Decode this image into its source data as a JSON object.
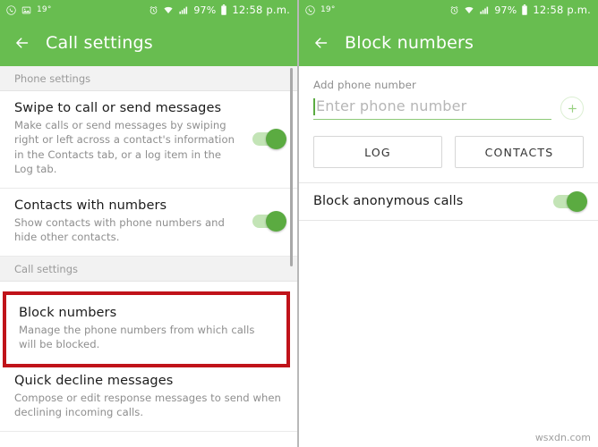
{
  "accent_green": "#68bd50",
  "highlight_red": "#c0131a",
  "toggle_on_color": "#5bab41",
  "left": {
    "statusbar": {
      "icons_left": [
        "whatsapp-icon",
        "gallery-icon"
      ],
      "temperature": "19°",
      "icons_right": [
        "alarm-icon",
        "wifi-icon",
        "signal-icon"
      ],
      "battery_percent": "97%",
      "time": "12:58 p.m."
    },
    "appbar": {
      "back": "back-arrow-icon",
      "title": "Call settings"
    },
    "sections": [
      {
        "header": "Phone settings",
        "items": [
          {
            "title": "Swipe to call or send messages",
            "subtitle": "Make calls or send messages by swiping right or left across a contact's information in the Contacts tab, or a log item in the Log tab.",
            "toggle": "on"
          },
          {
            "title": "Contacts with numbers",
            "subtitle": "Show contacts with phone numbers and hide other contacts.",
            "toggle": "on"
          }
        ]
      },
      {
        "header": "Call settings",
        "items": [
          {
            "title": "Block numbers",
            "subtitle": "Manage the phone numbers from which calls will be blocked.",
            "highlighted": true
          },
          {
            "title": "Quick decline messages",
            "subtitle": "Compose or edit response messages to send when declining incoming calls."
          }
        ]
      }
    ]
  },
  "right": {
    "statusbar": {
      "icons_left": [
        "whatsapp-icon"
      ],
      "temperature": "19°",
      "icons_right": [
        "alarm-icon",
        "wifi-icon",
        "signal-icon"
      ],
      "battery_percent": "97%",
      "time": "12:58 p.m."
    },
    "appbar": {
      "back": "back-arrow-icon",
      "title": "Block numbers"
    },
    "add_number": {
      "label": "Add phone number",
      "placeholder": "Enter phone number",
      "value": "",
      "add_button": "plus-icon"
    },
    "buttons": [
      {
        "label": "LOG"
      },
      {
        "label": "CONTACTS"
      }
    ],
    "anonymous": {
      "label": "Block anonymous calls",
      "toggle": "on"
    }
  },
  "watermark": "wsxdn.com"
}
